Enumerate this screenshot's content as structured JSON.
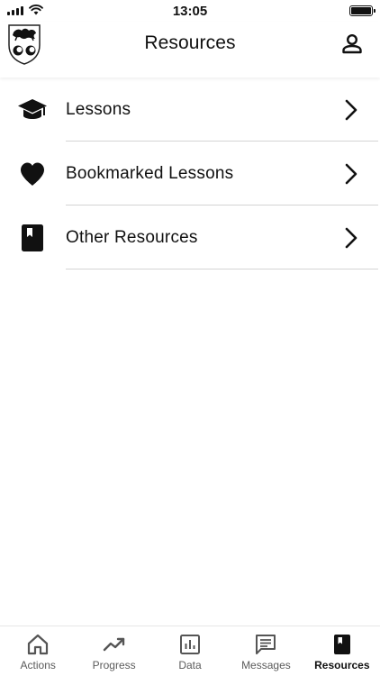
{
  "status_bar": {
    "time": "13:05"
  },
  "header": {
    "title": "Resources"
  },
  "resources": [
    {
      "label": "Lessons",
      "icon": "graduation-cap-icon"
    },
    {
      "label": "Bookmarked Lessons",
      "icon": "heart-icon"
    },
    {
      "label": "Other Resources",
      "icon": "book-icon"
    }
  ],
  "tab_bar": {
    "active": "Resources",
    "tabs": [
      {
        "label": "Actions",
        "icon": "home-icon"
      },
      {
        "label": "Progress",
        "icon": "trending-up-icon"
      },
      {
        "label": "Data",
        "icon": "bar-chart-icon"
      },
      {
        "label": "Messages",
        "icon": "message-icon"
      },
      {
        "label": "Resources",
        "icon": "book-icon"
      }
    ]
  }
}
